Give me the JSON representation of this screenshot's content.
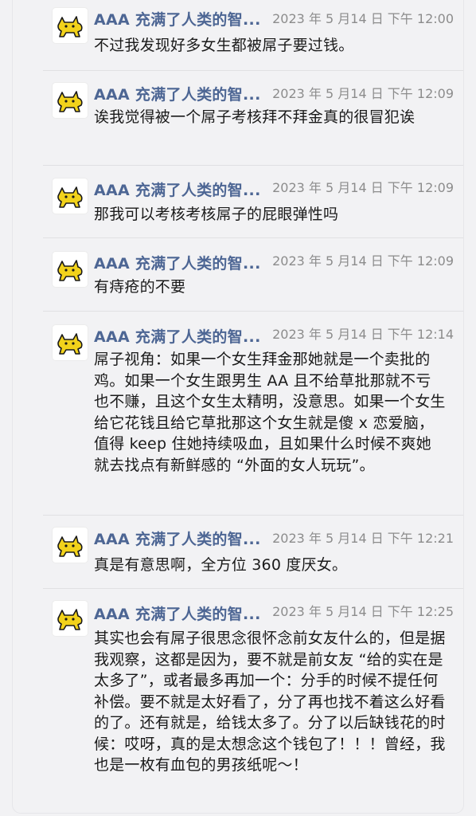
{
  "messages": [
    {
      "name": "AAA 充满了人类的智...",
      "time": "2023 年 5 月14 日 下午 12:00",
      "text": "不过我发现好多女生都被屌子要过钱。"
    },
    {
      "name": "AAA 充满了人类的智...",
      "time": "2023 年 5 月14 日 下午 12:09",
      "text": "诶我觉得被一个屌子考核拜不拜金真的很冒犯诶"
    },
    {
      "name": "AAA 充满了人类的智...",
      "time": "2023 年 5 月14 日 下午 12:09",
      "text": "那我可以考核考核屌子的屁眼弹性吗"
    },
    {
      "name": "AAA 充满了人类的智...",
      "time": "2023 年 5 月14 日 下午 12:09",
      "text": "有痔疮的不要"
    },
    {
      "name": "AAA 充满了人类的智...",
      "time": "2023 年 5 月14 日 下午 12:14",
      "text": "屌子视角：如果一个女生拜金那她就是一个卖批的鸡。如果一个女生跟男生 AA 且不给草批那就不亏也不赚，且这个女生太精明，没意思。如果一个女生给它花钱且给它草批那这个女生就是傻 x 恋爱脑，值得 keep 住她持续吸血，且如果什么时候不爽她就去找点有新鲜感的 “外面的女人玩玩”。"
    },
    {
      "name": "AAA 充满了人类的智...",
      "time": "2023 年 5 月14 日 下午 12:21",
      "text": "真是有意思啊，全方位 360 度厌女。"
    },
    {
      "name": "AAA 充满了人类的智...",
      "time": "2023 年 5 月14 日 下午 12:25",
      "text": "其实也会有屌子很思念很怀念前女友什么的，但是据我观察，这都是因为，要不就是前女友 “给的实在是太多了”，或者最多再加一个：分手的时候不提任何补偿。要不就是太好看了，分了再也找不着这么好看的了。还有就是，给钱太多了。分了以后缺钱花的时候：哎呀，真的是太想念这个钱包了！！！曾经，我也是一枚有血包的男孩纸呢～！"
    }
  ],
  "icons": {
    "thread": "comment-icon",
    "avatar": "yellow-cat-icon"
  },
  "colors": {
    "name": "#4d6694",
    "time": "#8c8c8c",
    "text": "#1a1a1a",
    "accent": "#3b63b8"
  }
}
